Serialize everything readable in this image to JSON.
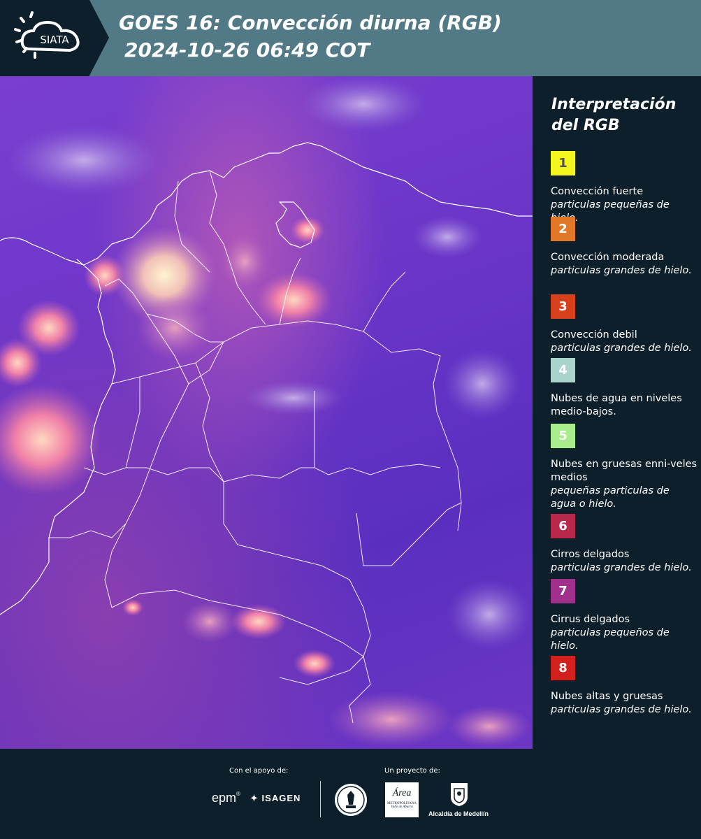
{
  "header": {
    "title_line1": "GOES 16: Convección diurna (RGB)",
    "title_line2": "2024-10-26 06:49 COT",
    "logo_text": "SIATA"
  },
  "legend": {
    "title_line1": "Interpretación",
    "title_line2": "del RGB",
    "items": [
      {
        "num": "1",
        "color": "#f5f51e",
        "text_color": "#555555",
        "name": "Convección fuerte",
        "desc": "particulas pequeñas de hielo."
      },
      {
        "num": "2",
        "color": "#e07828",
        "text_color": "#ffffff",
        "name": "Convección moderada",
        "desc": "particulas grandes de hielo."
      },
      {
        "num": "3",
        "color": "#d8401c",
        "text_color": "#ffffff",
        "name": "Convección debil",
        "desc": "particulas grandes de hielo."
      },
      {
        "num": "4",
        "color": "#a8d4cc",
        "text_color": "#ffffff",
        "name": "Nubes de agua en niveles medio-bajos.",
        "desc": ""
      },
      {
        "num": "5",
        "color": "#a8ec8c",
        "text_color": "#ffffff",
        "name": "Nubes en gruesas enni-veles medios",
        "desc": "pequeñas particulas de agua o hielo."
      },
      {
        "num": "6",
        "color": "#b8284a",
        "text_color": "#ffffff",
        "name": "Cirros delgados",
        "desc": "particulas grandes de hielo."
      },
      {
        "num": "7",
        "color": "#a0308c",
        "text_color": "#ffffff",
        "name": "Cirrus delgados",
        "desc": "particulas pequeños de hielo."
      },
      {
        "num": "8",
        "color": "#d4201c",
        "text_color": "#ffffff",
        "name": "Nubes altas y gruesas",
        "desc": "particulas grandes de hielo."
      }
    ]
  },
  "footer": {
    "support_label": "Con el apoyo de:",
    "project_label": "Un proyecto de:",
    "sponsors": [
      "epm",
      "ISAGEN"
    ],
    "partner_area_name": "Área",
    "partner_area_sub": "METROPOLITANA",
    "partner_area_sub2": "Valle de Aburrá",
    "partner_medellin": "Alcaldía de Medellín"
  }
}
